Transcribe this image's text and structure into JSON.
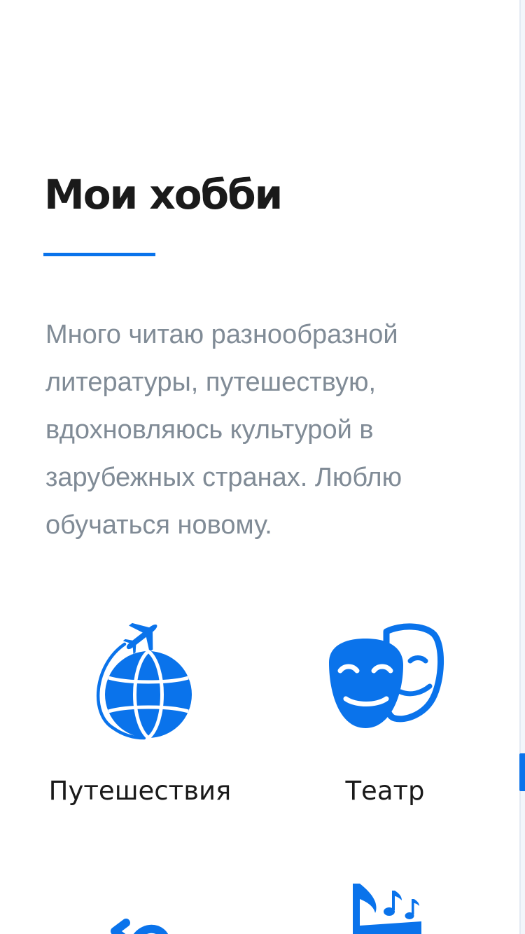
{
  "section": {
    "title": "Мои хобби",
    "description": "Много читаю разнообразной литературы, путешествую, вдохновляюсь культурой в зарубежных странах. Люблю обучаться новому."
  },
  "hobbies": [
    {
      "label": "Путешествия",
      "icon": "globe-plane-icon"
    },
    {
      "label": "Театр",
      "icon": "theatre-masks-icon"
    },
    {
      "label": "",
      "icon": "partial-icon"
    },
    {
      "label": "",
      "icon": "music-notes-icon"
    }
  ],
  "colors": {
    "accent": "#0a73eb",
    "title": "#1a1a1a",
    "description": "#808b96",
    "background": "#ffffff"
  }
}
